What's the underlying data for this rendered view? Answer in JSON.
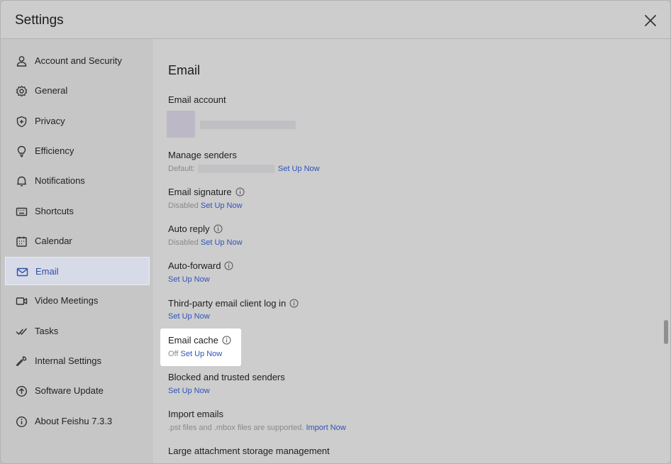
{
  "header": {
    "title": "Settings"
  },
  "sidebar": {
    "items": [
      {
        "label": "Account and Security"
      },
      {
        "label": "General"
      },
      {
        "label": "Privacy"
      },
      {
        "label": "Efficiency"
      },
      {
        "label": "Notifications"
      },
      {
        "label": "Shortcuts"
      },
      {
        "label": "Calendar"
      },
      {
        "label": "Email"
      },
      {
        "label": "Video Meetings"
      },
      {
        "label": "Tasks"
      },
      {
        "label": "Internal Settings"
      },
      {
        "label": "Software Update"
      },
      {
        "label": "About Feishu 7.3.3"
      }
    ],
    "active_index": 7
  },
  "main": {
    "title": "Email",
    "email_account": {
      "title": "Email account"
    },
    "manage_senders": {
      "title": "Manage senders",
      "prefix": "Default:",
      "link": "Set Up Now"
    },
    "email_signature": {
      "title": "Email signature",
      "status": "Disabled",
      "link": "Set Up Now"
    },
    "auto_reply": {
      "title": "Auto reply",
      "status": "Disabled",
      "link": "Set Up Now"
    },
    "auto_forward": {
      "title": "Auto-forward",
      "link": "Set Up Now"
    },
    "third_party": {
      "title": "Third-party email client log in",
      "link": "Set Up Now"
    },
    "email_cache": {
      "title": "Email cache",
      "status": "Off",
      "link": "Set Up Now"
    },
    "blocked": {
      "title": "Blocked and trusted senders",
      "link": "Set Up Now"
    },
    "import": {
      "title": "Import emails",
      "desc": ".pst files and .mbox files are supported.",
      "link": "Import Now"
    },
    "large_attachment": {
      "title": "Large attachment storage management"
    }
  },
  "colors": {
    "accent": "#2f52b8",
    "active_bg": "#d7dbe8",
    "highlight": "#ffffff"
  }
}
